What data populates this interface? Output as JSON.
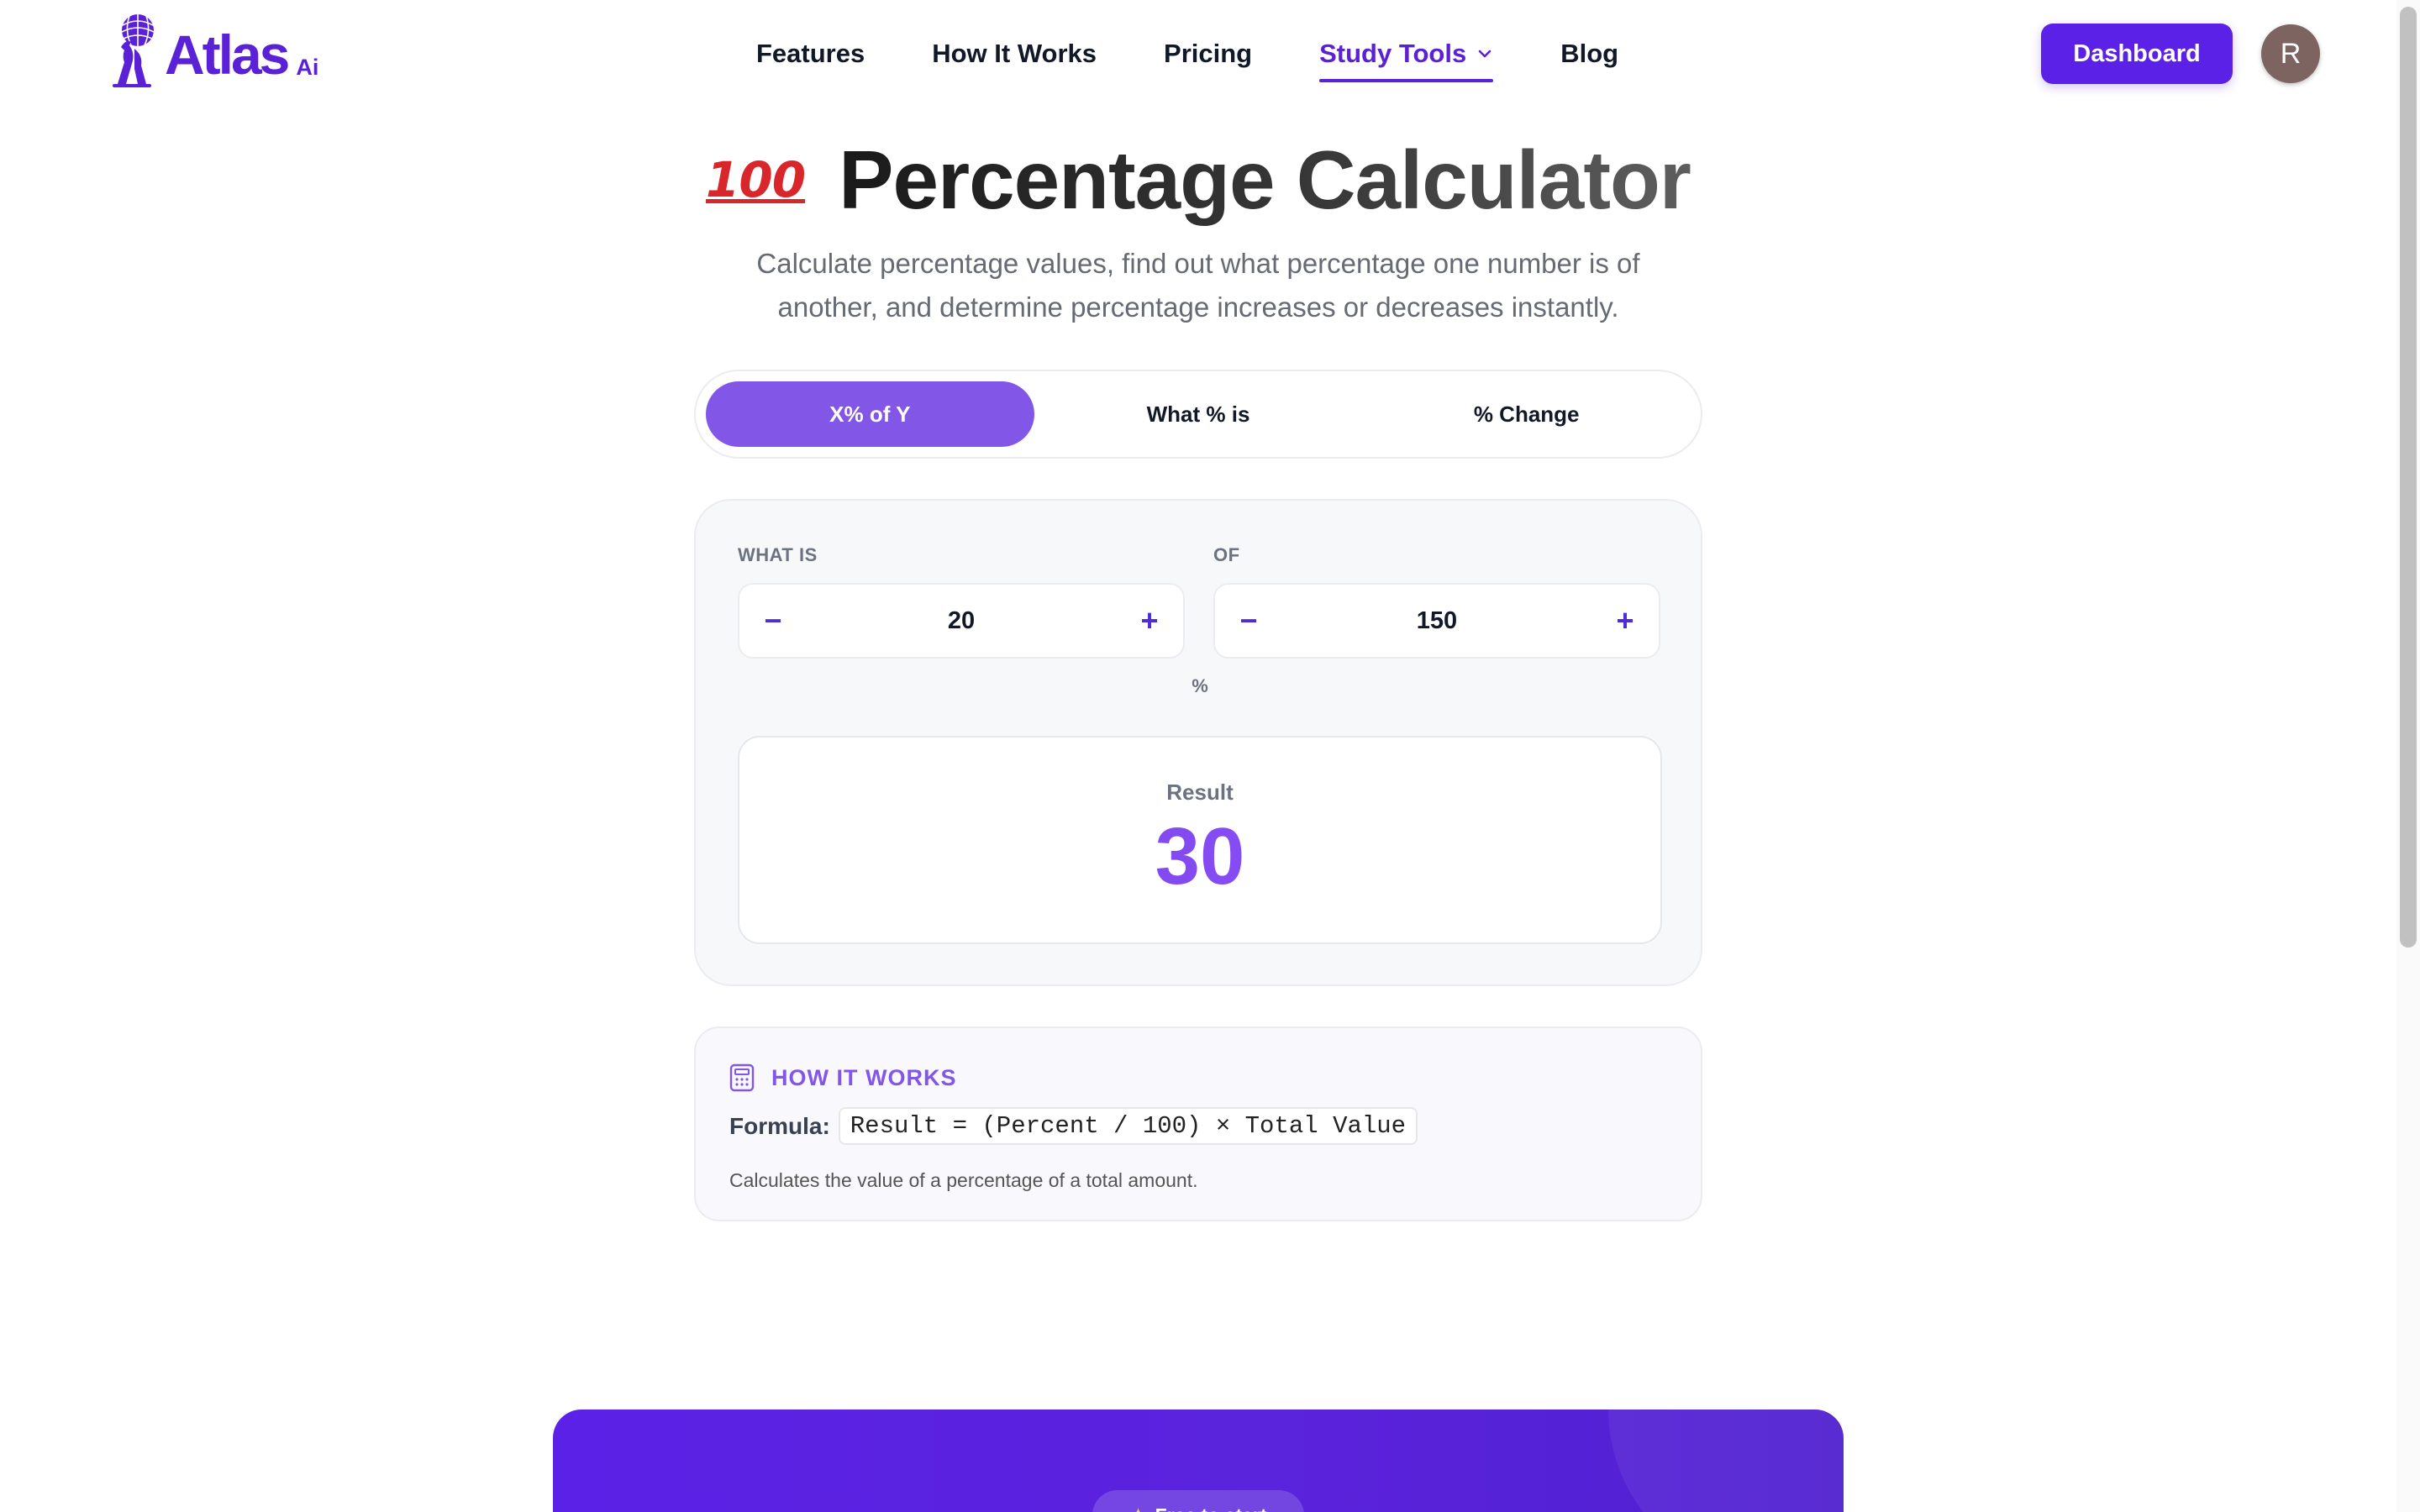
{
  "brand": {
    "name": "Atlas",
    "suffix": "Ai"
  },
  "nav": {
    "links": [
      {
        "label": "Features"
      },
      {
        "label": "How It Works"
      },
      {
        "label": "Pricing"
      },
      {
        "label": "Study Tools",
        "active": true,
        "has_dropdown": true
      },
      {
        "label": "Blog"
      }
    ],
    "dashboard_label": "Dashboard",
    "avatar_initial": "R"
  },
  "hero": {
    "emoji": "💯",
    "title": "Percentage Calculator",
    "subtitle": "Calculate percentage values, find out what percentage one number is of another, and determine percentage increases or decreases instantly."
  },
  "tabs": [
    {
      "label": "X% of Y",
      "active": true
    },
    {
      "label": "What % is",
      "active": false
    },
    {
      "label": "% Change",
      "active": false
    }
  ],
  "calculator": {
    "left_label": "WHAT IS",
    "left_value": "20",
    "right_label": "OF",
    "right_value": "150",
    "minus": "−",
    "plus": "+",
    "percent_sign": "%",
    "result_label": "Result",
    "result_value": "30"
  },
  "how_it_works": {
    "title": "HOW IT WORKS",
    "formula_label": "Formula:",
    "formula": "Result = (Percent / 100) × Total Value",
    "description": "Calculates the value of a percentage of a total amount."
  },
  "cta": {
    "badge": "Free to start"
  },
  "colors": {
    "brand": "#5b21e6",
    "accent": "#8257e8",
    "text": "#111827"
  }
}
